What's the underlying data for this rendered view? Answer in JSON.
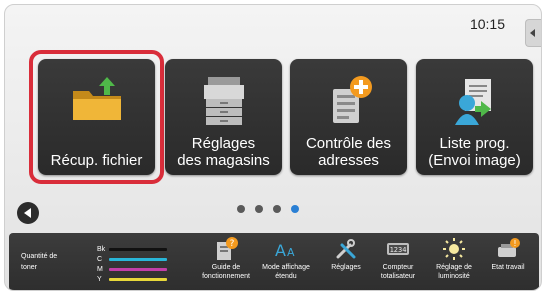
{
  "status": {
    "time": "10:15"
  },
  "tiles": [
    {
      "label_line1": "Récup. fichier",
      "label_line2": ""
    },
    {
      "label_line1": "Réglages",
      "label_line2": "des magasins"
    },
    {
      "label_line1": "Contrôle des",
      "label_line2": "adresses"
    },
    {
      "label_line1": "Liste prog.",
      "label_line2": "(Envoi image)"
    }
  ],
  "pager": {
    "pages": 4,
    "current": 4
  },
  "toner": {
    "label_line1": "Quantité de",
    "label_line2": "toner",
    "rows": [
      {
        "name": "Bk",
        "color": "#111111"
      },
      {
        "name": "C",
        "color": "#29b6d8"
      },
      {
        "name": "M",
        "color": "#c23fa8"
      },
      {
        "name": "Y",
        "color": "#e8d83a"
      }
    ]
  },
  "tools": [
    {
      "label": "Guide de fonctionnement",
      "icon": "book-question-icon"
    },
    {
      "label": "Mode affichage étendu",
      "icon": "font-size-icon"
    },
    {
      "label": "Réglages",
      "icon": "tools-icon"
    },
    {
      "label": "Compteur totalisateur",
      "icon": "counter-icon"
    },
    {
      "label": "Réglage de luminosité",
      "icon": "brightness-icon"
    },
    {
      "label": "Etat travail",
      "icon": "job-status-icon"
    }
  ],
  "colors": {
    "highlight": "#d92d3a",
    "accent": "#2a7fd4",
    "tile": "#2f2f2f"
  }
}
